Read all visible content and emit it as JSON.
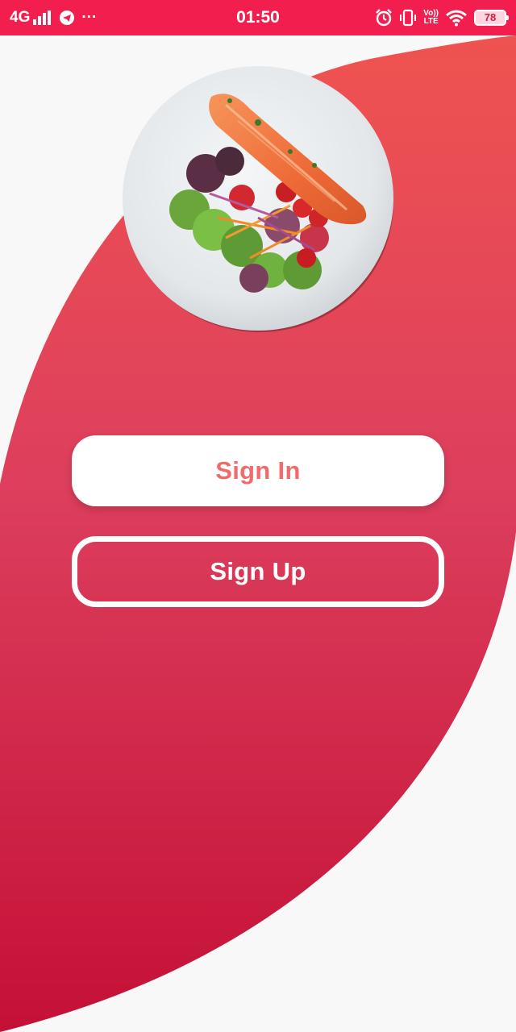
{
  "status_bar": {
    "network": "4G",
    "time": "01:50",
    "more": "···",
    "volte_top": "Vo))",
    "volte_bottom": "LTE",
    "battery": "78"
  },
  "icons": {
    "signal": "signal-bars-icon",
    "telegram": "telegram-icon",
    "alarm": "alarm-clock-icon",
    "vibrate": "vibrate-icon",
    "wifi": "wifi-icon",
    "battery": "battery-icon"
  },
  "colors": {
    "status_bar": "#f21f4e",
    "gradient_top": "#ef5350",
    "gradient_mid": "#dd3f5d",
    "gradient_bottom": "#c41036",
    "signin_text": "#ee6c6c",
    "background": "#f8f8f8"
  },
  "main": {
    "signin_label": "Sign In",
    "signup_label": "Sign Up"
  }
}
